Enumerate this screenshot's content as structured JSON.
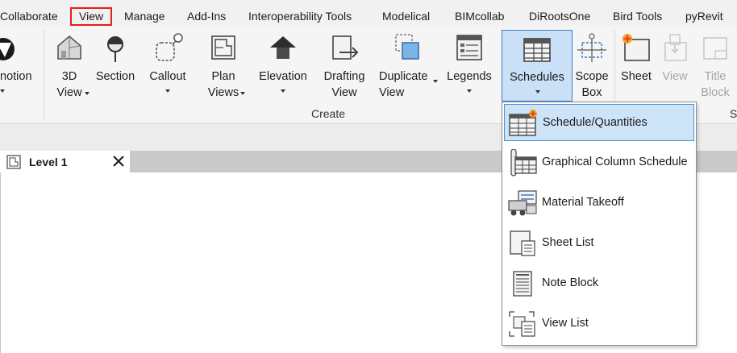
{
  "menu": {
    "items": [
      {
        "label": "Collaborate"
      },
      {
        "label": "View",
        "active": true
      },
      {
        "label": "Manage"
      },
      {
        "label": "Add-Ins"
      },
      {
        "label": "Interoperability Tools"
      },
      {
        "label": "Modelical"
      },
      {
        "label": "BIMcollab"
      },
      {
        "label": "DiRootsOne"
      },
      {
        "label": "Bird Tools"
      },
      {
        "label": "pyRevit"
      }
    ]
  },
  "ribbon": {
    "left_partial_label": "notion",
    "buttons": {
      "view3d": "3D\nView",
      "section": "Section",
      "callout": "Callout",
      "plan_views": "Plan\nViews",
      "elevation": "Elevation",
      "drafting_view": "Drafting\nView",
      "duplicate_view": "Duplicate\nView",
      "legends": "Legends",
      "schedules": "Schedules",
      "scope_box": "Scope\nBox",
      "sheet": "Sheet",
      "view": "View",
      "title_block": "Title\nBlock"
    },
    "panel_create": "Create",
    "panel_sheet_partial": "S"
  },
  "view_tab": {
    "label": "Level 1",
    "close": "✕"
  },
  "dropdown": {
    "items": [
      {
        "label": "Schedule/Quantities",
        "icon": "schedule-quantities-icon",
        "highlight": true
      },
      {
        "label": "Graphical Column Schedule",
        "icon": "graphical-column-schedule-icon"
      },
      {
        "label": "Material Takeoff",
        "icon": "material-takeoff-icon"
      },
      {
        "label": "Sheet List",
        "icon": "sheet-list-icon"
      },
      {
        "label": "Note Block",
        "icon": "note-block-icon"
      },
      {
        "label": "View List",
        "icon": "view-list-icon"
      }
    ]
  },
  "colors": {
    "active_outline": "#e81c1c",
    "selected_bg": "#c9e0f7",
    "selected_border": "#3c7fc3",
    "highlight_bg": "#cde4f8"
  }
}
